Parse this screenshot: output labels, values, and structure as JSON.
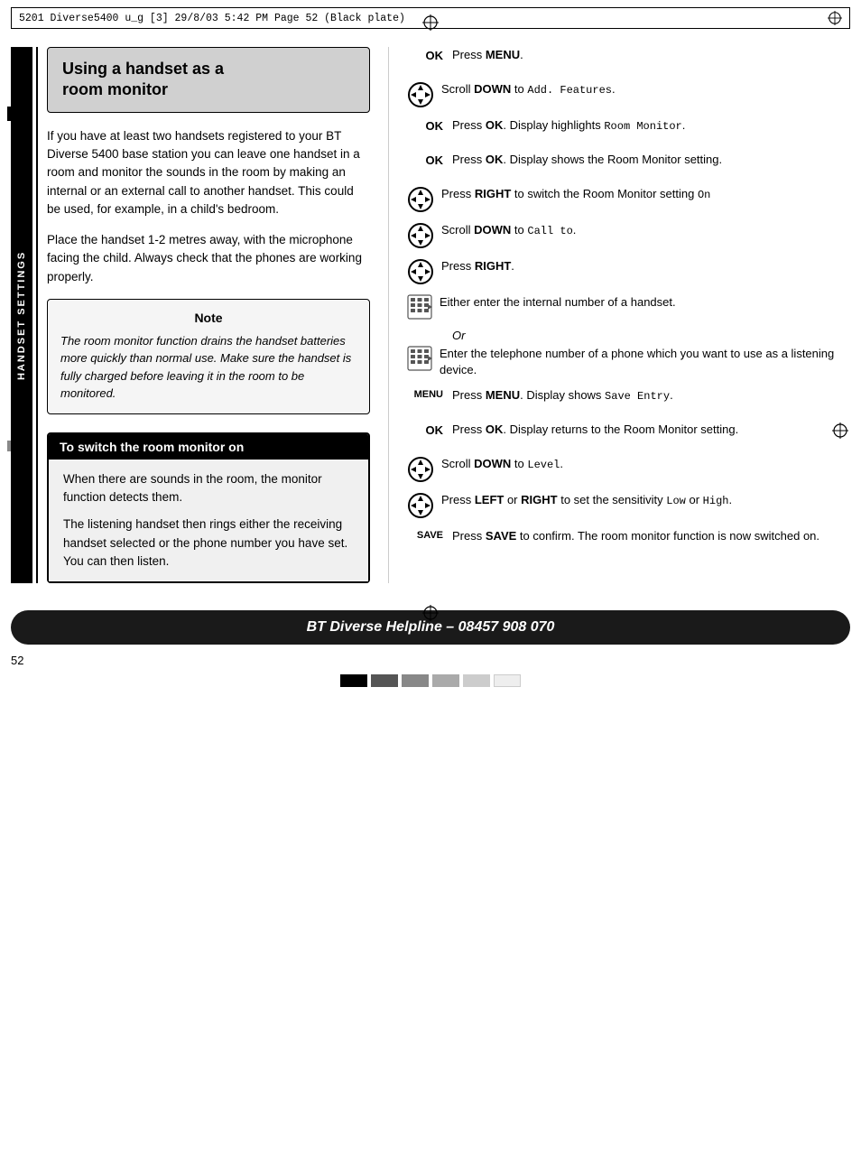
{
  "header": {
    "text": "5201 Diverse5400   u_g [3]   29/8/03   5:42 PM   Page 52    (Black plate)"
  },
  "section_title": {
    "line1": "Using a handset as a",
    "line2": "room monitor"
  },
  "body_paragraphs": [
    "If you have at least two handsets registered to your BT Diverse 5400 base station you can leave one handset in a room and monitor the sounds in the room by making an internal or an external call to another handset. This could be used, for example, in a child's bedroom.",
    "Place the handset 1-2 metres away, with the microphone facing the child. Always check that the phones are working properly."
  ],
  "note": {
    "title": "Note",
    "body": "The room monitor function drains the handset batteries more quickly than normal use. Make sure the handset is fully charged before leaving it in the room to be monitored."
  },
  "switch_on": {
    "title": "To switch the room monitor on",
    "paragraphs": [
      "When there are sounds in the room, the monitor function detects them.",
      "The listening handset then rings either the receiving handset selected or the phone number you have set. You can then listen."
    ]
  },
  "instructions": [
    {
      "key": "OK",
      "type": "text",
      "text": "Press <b>MENU</b>."
    },
    {
      "key": "nav",
      "type": "nav",
      "text": "Scroll <b>DOWN</b> to <span class=\"mono\">Add. Features</span>."
    },
    {
      "key": "OK",
      "type": "text",
      "text": "Press <b>OK</b>. Display highlights <span class=\"mono\">Room Monitor</span>."
    },
    {
      "key": "OK",
      "type": "text",
      "text": "Press <b>OK</b>. Display shows the Room Monitor setting."
    },
    {
      "key": "nav",
      "type": "nav",
      "text": "Press <b>RIGHT</b> to switch the Room Monitor setting <span class=\"mono\">On</span>"
    },
    {
      "key": "nav",
      "type": "nav",
      "text": "Scroll <b>DOWN</b> to <span class=\"mono\">Call to</span>."
    },
    {
      "key": "nav",
      "type": "nav",
      "text": "Press <b>RIGHT</b>."
    },
    {
      "key": "keypad",
      "type": "keypad",
      "text": "Either enter the internal number of a handset."
    },
    {
      "key": "or",
      "type": "or",
      "text": "Or"
    },
    {
      "key": "keypad",
      "type": "keypad",
      "text": "Enter the telephone number of a phone which you want to use as a listening device."
    },
    {
      "key": "MENU",
      "type": "text",
      "text": "Press <b>MENU</b>. Display shows <span class=\"mono\">Save Entry</span>."
    },
    {
      "key": "OK",
      "type": "text",
      "text": "Press <b>OK</b>. Display returns to the Room Monitor setting."
    },
    {
      "key": "nav",
      "type": "nav",
      "text": "Scroll <b>DOWN</b> to <span class=\"mono\">Level</span>."
    },
    {
      "key": "nav",
      "type": "nav",
      "text": "Press <b>LEFT</b> or <b>RIGHT</b> to set the sensitivity <span class=\"mono\">Low</span> or <span class=\"mono\">High</span>."
    },
    {
      "key": "SAVE",
      "type": "text",
      "text": "Press <b>SAVE</b> to confirm. The room monitor function is now switched on."
    }
  ],
  "footer": {
    "text": "BT Diverse Helpline – 08457 908 070"
  },
  "page_number": "52",
  "sidebar_label": "HANDSET SETTINGS"
}
